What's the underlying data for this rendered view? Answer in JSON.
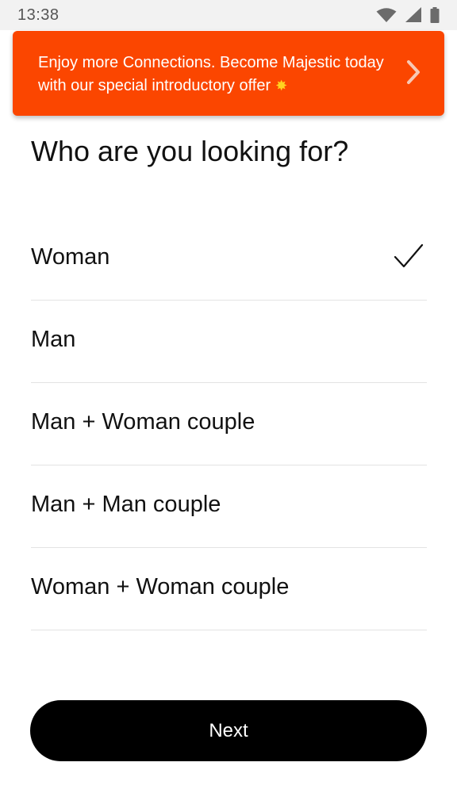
{
  "status_bar": {
    "time": "13:38",
    "icons": [
      "wifi-icon",
      "cell-signal-icon",
      "battery-icon"
    ]
  },
  "promo_banner": {
    "text": "Enjoy more Connections. Become Majestic today with our special introductory offer",
    "sparkle": "✸",
    "icon": "chevron-right-icon",
    "background_color": "#fb4600"
  },
  "title": "Who are you looking for?",
  "options": [
    {
      "label": "Woman",
      "selected": true
    },
    {
      "label": "Man",
      "selected": false
    },
    {
      "label": "Man + Woman couple",
      "selected": false
    },
    {
      "label": "Man + Man couple",
      "selected": false
    },
    {
      "label": "Woman + Woman couple",
      "selected": false
    }
  ],
  "next_button": {
    "label": "Next"
  }
}
